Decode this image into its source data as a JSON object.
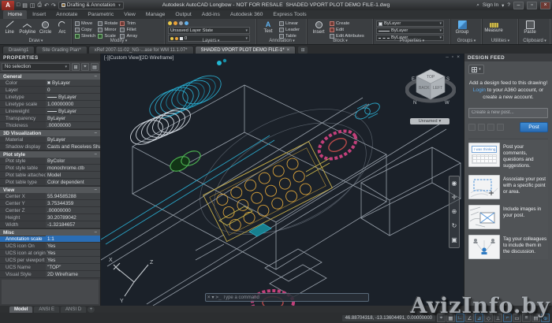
{
  "colors": {
    "accent_blue": "#2e7bc4",
    "autocad_red": "#a32f27",
    "canvas_bg": "#1b2129",
    "selection_blue": "#2a6db5"
  },
  "icons": {
    "search": "⌕",
    "minimize": "–",
    "restore": "▫",
    "close": "×",
    "chevron": "▾",
    "plus": "+",
    "help": "?",
    "text_tool": "A",
    "new_tab": "⊞",
    "prompt": ">_"
  },
  "title_bar": {
    "app_name": "A",
    "quick_access": [
      "□",
      "▤",
      "◫",
      "⎙",
      "↶",
      "↷"
    ],
    "workspace": "Drafting & Annotation",
    "title": "Autodesk AutoCAD Longbow - NOT FOR RESALE",
    "doc_name": "SHADED VPORT PLOT DEMO FILE-1.dwg",
    "sign_in_label": "Sign In"
  },
  "ribbon_tabs": [
    {
      "label": "Home"
    },
    {
      "label": "Insert"
    },
    {
      "label": "Annotate"
    },
    {
      "label": "Parametric"
    },
    {
      "label": "View"
    },
    {
      "label": "Manage"
    },
    {
      "label": "Output"
    },
    {
      "label": "Add-ins"
    },
    {
      "label": "Autodesk 360"
    },
    {
      "label": "Express Tools"
    }
  ],
  "ribbon": {
    "draw": {
      "label": "Draw",
      "buttons": [
        "Line",
        "Polyline",
        "Circle",
        "Arc"
      ]
    },
    "modify": {
      "label": "Modify",
      "col1": [
        "Move",
        "Copy",
        "Stretch"
      ],
      "col2": [
        "Rotate",
        "Mirror",
        "Scale"
      ],
      "col3": [
        "Trim",
        "Fillet",
        "Array"
      ]
    },
    "layers": {
      "label": "Layers",
      "layer_state": "Unsaved Layer State",
      "current_layer": "0"
    },
    "annotation": {
      "label": "Annotation",
      "big": "Text",
      "items": [
        "Linear",
        "Leader",
        "Table"
      ]
    },
    "block": {
      "label": "Block",
      "big": "Insert",
      "items": [
        "Create",
        "Edit",
        "Edit Attributes"
      ]
    },
    "properties": {
      "label": "Properties",
      "rows": [
        "ByLayer",
        "ByLayer",
        "ByLayer"
      ]
    },
    "groups": {
      "label": "Groups",
      "big": "Group"
    },
    "utilities": {
      "label": "Utilities",
      "big": "Measure"
    },
    "clipboard": {
      "label": "Clipboard",
      "big": "Paste"
    }
  },
  "file_tabs": [
    {
      "label": "Drawing1"
    },
    {
      "label": "Site Grading Plan*"
    },
    {
      "label": "xRef 2007-11-02_NG-...ase for WM 11.1.07*"
    },
    {
      "label": "SHADED VPORT PLOT DEMO FILE-1*"
    }
  ],
  "properties_panel": {
    "title": "PROPERTIES",
    "selector": "No selection",
    "icons": [
      "⊞",
      "⌖",
      "▤"
    ],
    "sections": [
      {
        "title": "General",
        "rows": [
          {
            "label": "Color",
            "value": "ByLayer"
          },
          {
            "label": "Layer",
            "value": "0"
          },
          {
            "label": "Linetype",
            "value": "ByLayer"
          },
          {
            "label": "Linetype scale",
            "value": "1.00000000"
          },
          {
            "label": "Lineweight",
            "value": "ByLayer"
          },
          {
            "label": "Transparency",
            "value": "ByLayer"
          },
          {
            "label": "Thickness",
            "value": ".00000000"
          }
        ]
      },
      {
        "title": "3D Visualization",
        "rows": [
          {
            "label": "Material",
            "value": "ByLayer"
          },
          {
            "label": "Shadow display",
            "value": "Casts and Receives Shado..."
          }
        ]
      },
      {
        "title": "Plot style",
        "rows": [
          {
            "label": "Plot style",
            "value": "ByColor"
          },
          {
            "label": "Plot style table",
            "value": "monochrome.ctb"
          },
          {
            "label": "Plot table attached to",
            "value": "Model"
          },
          {
            "label": "Plot table type",
            "value": "Color dependent"
          }
        ]
      },
      {
        "title": "View",
        "rows": [
          {
            "label": "Center X",
            "value": "55.94585288"
          },
          {
            "label": "Center Y",
            "value": "3.75344359"
          },
          {
            "label": "Center Z",
            "value": ".00000000"
          },
          {
            "label": "Height",
            "value": "30.20789042"
          },
          {
            "label": "Width",
            "value": "-1.32184657"
          }
        ]
      },
      {
        "title": "Misc",
        "rows": [
          {
            "label": "Annotation scale",
            "value": "1:1"
          },
          {
            "label": "UCS icon On",
            "value": "Yes"
          },
          {
            "label": "UCS icon at origin",
            "value": "Yes"
          },
          {
            "label": "UCS per viewport",
            "value": "Yes"
          },
          {
            "label": "UCS Name",
            "value": "\"TOP\""
          },
          {
            "label": "Visual Style",
            "value": "2D Wireframe"
          }
        ]
      }
    ]
  },
  "viewport": {
    "label": "[-][Custom View][2D Wireframe]",
    "viewcube": {
      "top": "TOP",
      "left": "BACK",
      "right": "LEFT",
      "compass": {
        "n": "N",
        "s": "S",
        "e": "E",
        "w": "W"
      },
      "view_name": "Unnamed"
    },
    "navbar_icons": [
      "◉",
      "✛",
      "⊕",
      "↻",
      "▣"
    ],
    "ucs_axes": {
      "x": "X",
      "y": "Y",
      "z": "Z"
    },
    "command_line": {
      "prompt": ">_",
      "placeholder": "Type a command"
    }
  },
  "design_feed": {
    "title": "DESIGN FEED",
    "intro_line1": "Add a design feed to this drawing!",
    "login_link": "Login",
    "intro_line2": " to your A360 account, or create a new account.",
    "post_placeholder": "Create a new post...",
    "post_button": "Post",
    "items": [
      {
        "thumb_text": "I was thinking...",
        "text": "Post your comments, questions and suggestions."
      },
      {
        "text": "Associate your post with a specific point or area."
      },
      {
        "text": "Include images in your post."
      },
      {
        "text": "Tag your colleagues to include them in the discussion."
      }
    ]
  },
  "layout_tabs": [
    {
      "label": "Model"
    },
    {
      "label": "ANSI E"
    },
    {
      "label": "ANSI D"
    }
  ],
  "status_bar": {
    "coordinates": "46.88704318, -13.13604491, 0.00000000",
    "icons": [
      "⌖",
      "▦",
      "∟",
      "∠",
      "⊿",
      "◇",
      "⊥",
      "⌐",
      "▭",
      "≡",
      "▤",
      "⊕"
    ]
  },
  "watermark": "AvizInfo.by"
}
